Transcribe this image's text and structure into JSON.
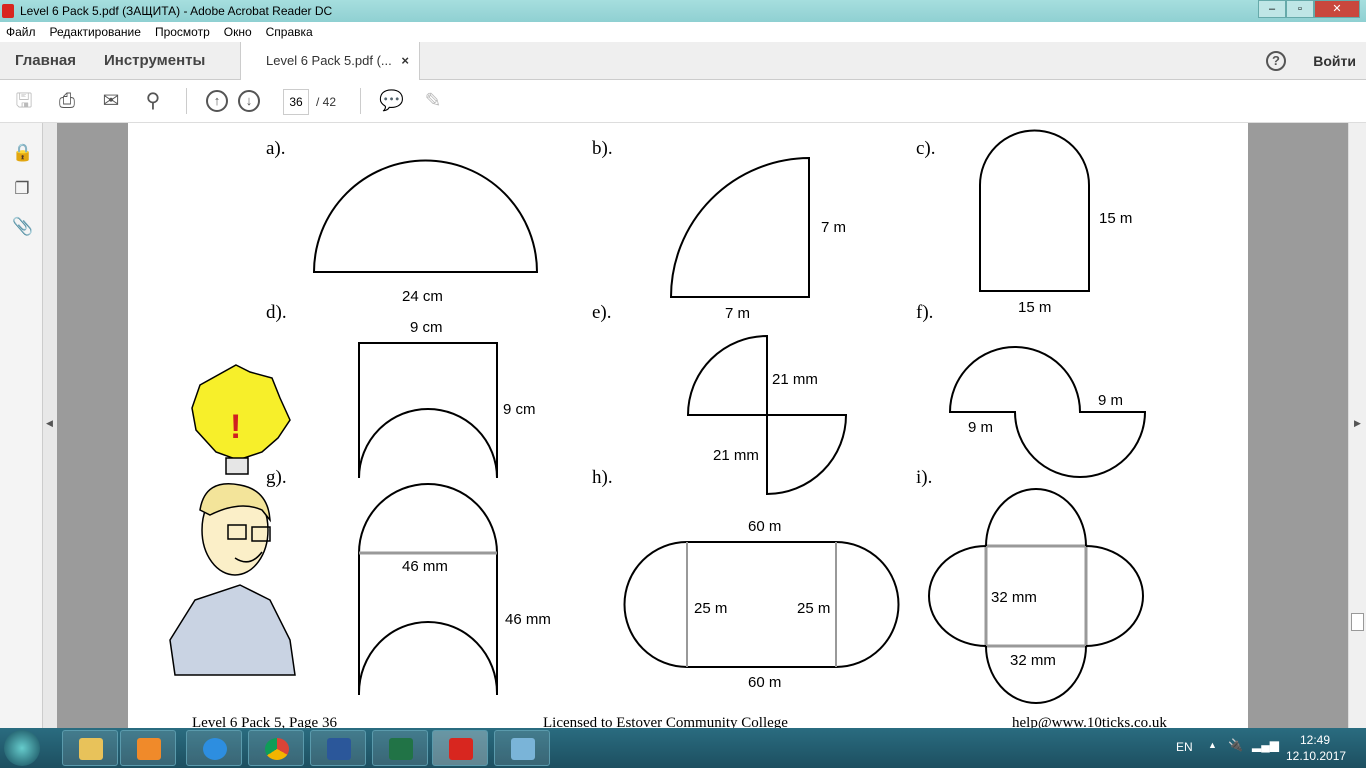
{
  "window": {
    "title": "Level 6 Pack 5.pdf (ЗАЩИТА) - Adobe Acrobat Reader DC"
  },
  "menu": [
    "Файл",
    "Редактирование",
    "Просмотр",
    "Окно",
    "Справка"
  ],
  "tabs": {
    "home": "Главная",
    "tools": "Инструменты",
    "document": "Level 6 Pack 5.pdf (...",
    "close": "×",
    "help": "?",
    "login": "Войти"
  },
  "toolbar": {
    "page_current": "36",
    "page_total": "/ 42"
  },
  "document": {
    "letters": [
      "a).",
      "b).",
      "c).",
      "d).",
      "e).",
      "f).",
      "g).",
      "h).",
      "i)."
    ],
    "labels": {
      "a_base": "24 cm",
      "b_side": "7 m",
      "b_base": "7 m",
      "c_side": "15 m",
      "c_base": "15 m",
      "d_top": "9 cm",
      "d_side": "9 cm",
      "e_top": "21 mm",
      "e_bottom": "21 mm",
      "f_right": "9 m",
      "f_left": "9 m",
      "g_mid": "46 mm",
      "g_side": "46 mm",
      "h_top": "60 m",
      "h_left": "25 m",
      "h_right": "25 m",
      "h_bottom": "60 m",
      "i_side": "32 mm",
      "i_bottom": "32 mm"
    },
    "footer": {
      "left": "Level 6 Pack 5, Page 36",
      "center": "Licensed to Estover Community College",
      "right": "help@www.10ticks.co.uk"
    }
  },
  "taskbar": {
    "lang": "EN",
    "time": "12:49",
    "date": "12.10.2017",
    "apps": [
      "explorer",
      "media-player",
      "internet-explorer",
      "chrome",
      "word",
      "excel",
      "acrobat",
      "photo-viewer"
    ]
  }
}
